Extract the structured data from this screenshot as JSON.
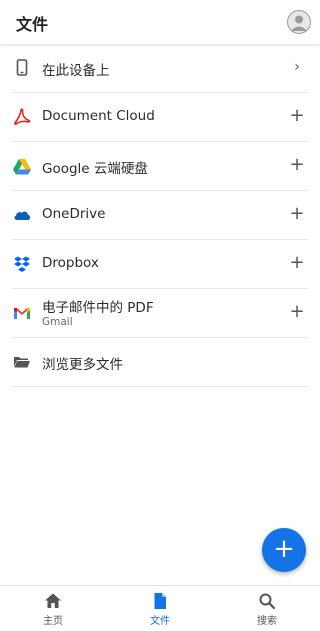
{
  "header": {
    "title": "文件"
  },
  "locations": [
    {
      "label": "在此设备上",
      "action": "›",
      "icon": "phone-icon"
    },
    {
      "label": "Document Cloud",
      "action": "+",
      "icon": "acrobat-icon"
    },
    {
      "label": "Google 云端硬盘",
      "action": "+",
      "icon": "google-drive-icon"
    },
    {
      "label": "OneDrive",
      "action": "+",
      "icon": "onedrive-icon"
    },
    {
      "label": "Dropbox",
      "action": "+",
      "icon": "dropbox-icon"
    },
    {
      "label": "电子邮件中的 PDF",
      "sublabel": "Gmail",
      "action": "+",
      "icon": "gmail-icon"
    },
    {
      "label": "浏览更多文件",
      "icon": "folder-icon"
    }
  ],
  "fab": {
    "label": "+"
  },
  "bottom_nav": [
    {
      "label": "主页",
      "icon": "home-icon",
      "active": false
    },
    {
      "label": "文件",
      "icon": "file-icon",
      "active": true
    },
    {
      "label": "搜索",
      "icon": "search-icon",
      "active": false
    }
  ],
  "colors": {
    "accent": "#1473e6",
    "acrobat_red": "#e3281b",
    "divider": "#e6e6e6"
  }
}
